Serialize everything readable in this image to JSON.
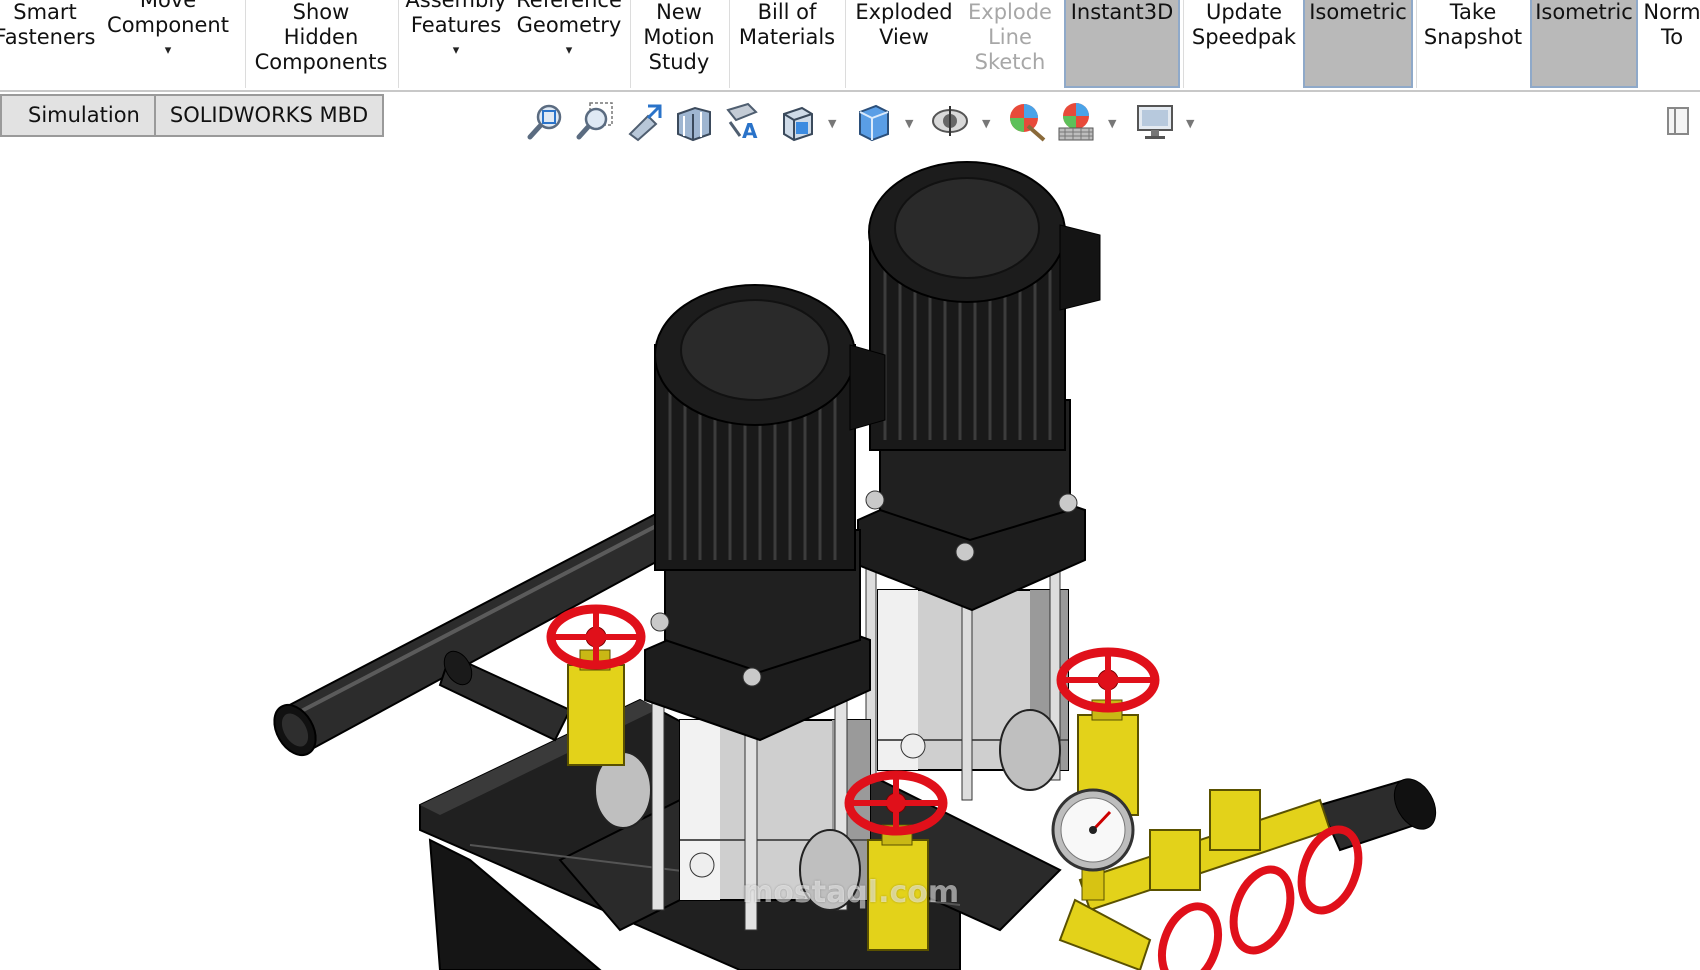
{
  "ribbon": {
    "buttons": [
      {
        "label": "Smart\nFasteners",
        "state": "normal"
      },
      {
        "label": "Move\nComponent",
        "state": "normal",
        "caret": "▾"
      },
      {
        "label": "Show\nHidden\nComponents",
        "state": "normal"
      },
      {
        "label": "Assembly\nFeatures",
        "state": "normal",
        "caret": "▾"
      },
      {
        "label": "Reference\nGeometry",
        "state": "normal",
        "caret": "▾"
      },
      {
        "label": "New\nMotion\nStudy",
        "state": "normal"
      },
      {
        "label": "Bill of\nMaterials",
        "state": "normal"
      },
      {
        "label": "Exploded\nView",
        "state": "normal"
      },
      {
        "label": "Explode\nLine\nSketch",
        "state": "disabled"
      },
      {
        "label": "Instant3D",
        "state": "active"
      },
      {
        "label": "Update\nSpeedpak",
        "state": "normal"
      },
      {
        "label": "Isometric",
        "state": "active"
      },
      {
        "label": "Take\nSnapshot",
        "state": "normal"
      },
      {
        "label": "Isometric",
        "state": "active"
      },
      {
        "label": "Norm\nTo",
        "state": "normal"
      }
    ]
  },
  "tabs": [
    {
      "label": "Simulation"
    },
    {
      "label": "SOLIDWORKS MBD"
    }
  ],
  "heads_up_toolbar": {
    "icons": [
      "zoom-to-fit-icon",
      "zoom-to-area-icon",
      "previous-view-icon",
      "section-view-icon",
      "dynamic-annotation-view-icon",
      "view-orientation-icon",
      "display-style-icon",
      "hide-show-items-icon",
      "edit-appearance-icon",
      "apply-scene-icon",
      "view-settings-icon"
    ],
    "collapse_icon": "panel-toggle-icon"
  },
  "viewport": {
    "model": "pump-assembly",
    "colors": {
      "motor": "#1c1c1c",
      "valve_handwheel": "#e0101a",
      "valve_body": "#e6d21a",
      "pump_body": "#cfcfcf",
      "frame": "#1a1a1a"
    }
  },
  "watermark": {
    "text": "mostaql.com"
  }
}
